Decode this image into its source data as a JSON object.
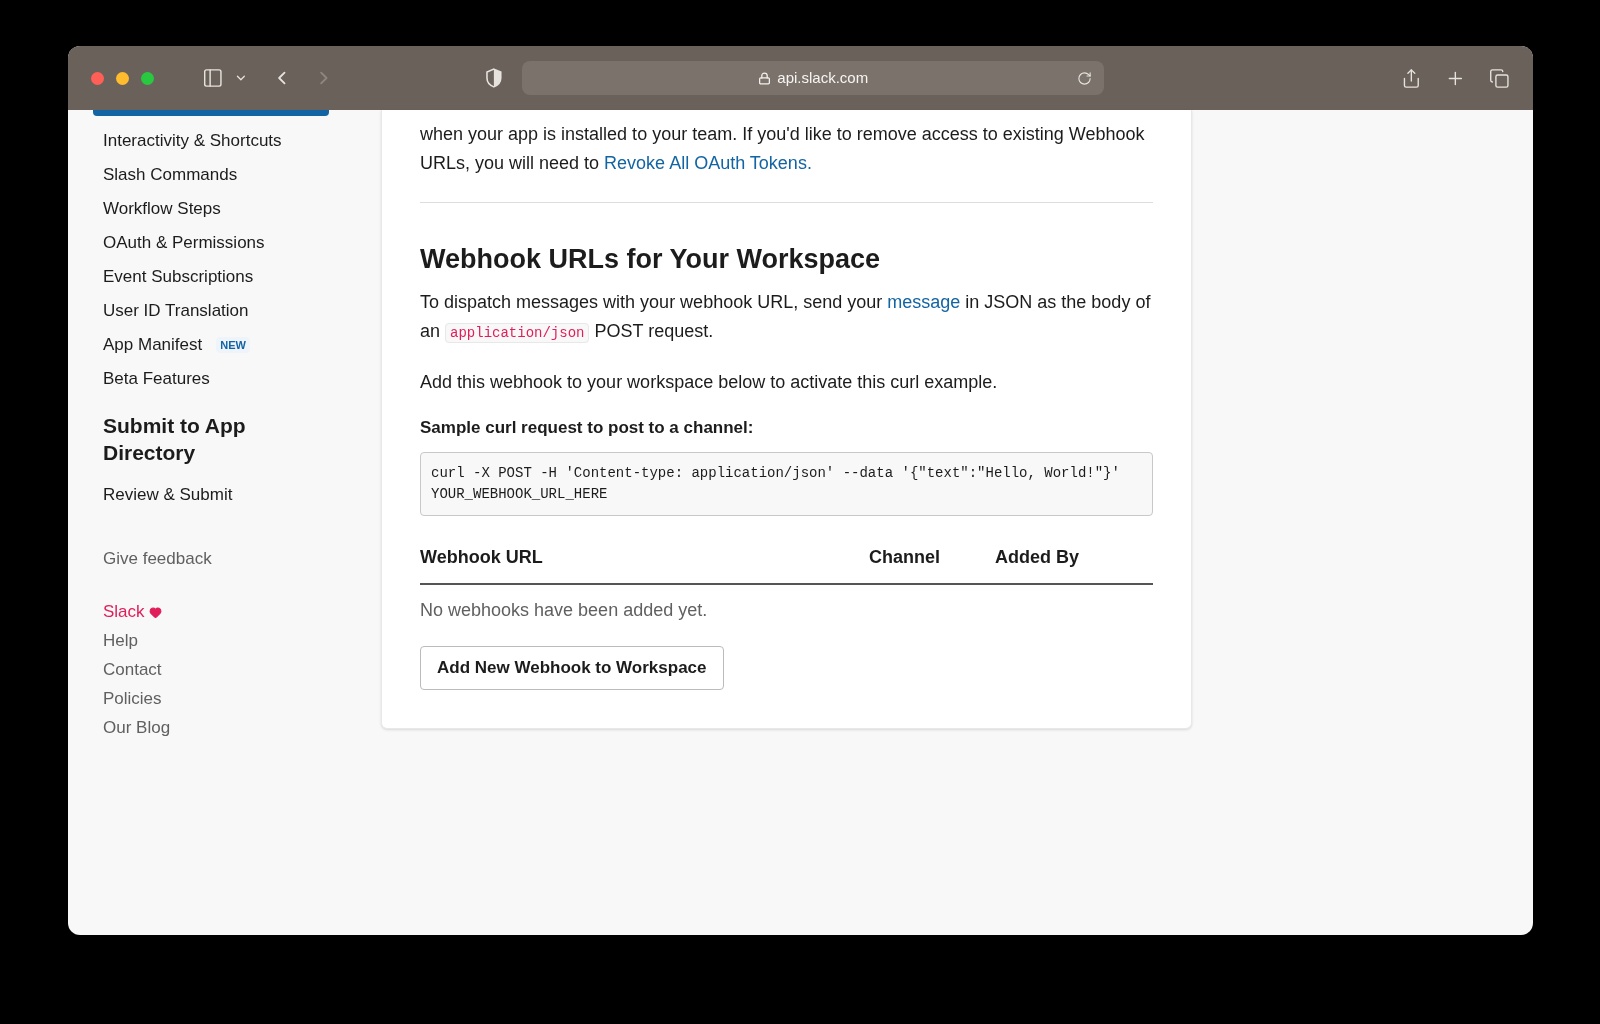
{
  "browser": {
    "address": "api.slack.com",
    "forward_disabled": true
  },
  "sidebar": {
    "items": [
      {
        "label": "Interactivity & Shortcuts"
      },
      {
        "label": "Slash Commands"
      },
      {
        "label": "Workflow Steps"
      },
      {
        "label": "OAuth & Permissions"
      },
      {
        "label": "Event Subscriptions"
      },
      {
        "label": "User ID Translation"
      },
      {
        "label": "App Manifest",
        "badge": "NEW"
      },
      {
        "label": "Beta Features"
      }
    ],
    "section_heading": "Submit to App Directory",
    "section_items": [
      {
        "label": "Review & Submit"
      }
    ],
    "feedback": "Give feedback",
    "footer_links": [
      {
        "label": "Slack",
        "kind": "brand"
      },
      {
        "label": "Help",
        "kind": "link"
      },
      {
        "label": "Contact",
        "kind": "link"
      },
      {
        "label": "Policies",
        "kind": "link"
      },
      {
        "label": "Our Blog",
        "kind": "link"
      }
    ]
  },
  "main": {
    "intro": [
      {
        "kind": "text",
        "text": "when your app is installed to your team. If you'd like to remove access to existing Webhook URLs, you will need to "
      },
      {
        "kind": "link",
        "text": "Revoke All OAuth Tokens."
      }
    ],
    "heading": "Webhook URLs for Your Workspace",
    "description": [
      {
        "kind": "text",
        "text": "To dispatch messages with your webhook URL, send your "
      },
      {
        "kind": "link",
        "text": "message"
      },
      {
        "kind": "text",
        "text": " in JSON as the body of an "
      },
      {
        "kind": "code",
        "text": "application/json"
      },
      {
        "kind": "text",
        "text": " POST request."
      }
    ],
    "activate_note": "Add this webhook to your workspace below to activate this curl example.",
    "sample_label": "Sample curl request to post to a channel:",
    "sample_code": "curl -X POST -H 'Content-type: application/json' --data '{\"text\":\"Hello, World!\"}' YOUR_WEBHOOK_URL_HERE",
    "table": {
      "columns": [
        "Webhook URL",
        "Channel",
        "Added By"
      ],
      "empty_text": "No webhooks have been added yet."
    },
    "add_button": "Add New Webhook to Workspace"
  }
}
